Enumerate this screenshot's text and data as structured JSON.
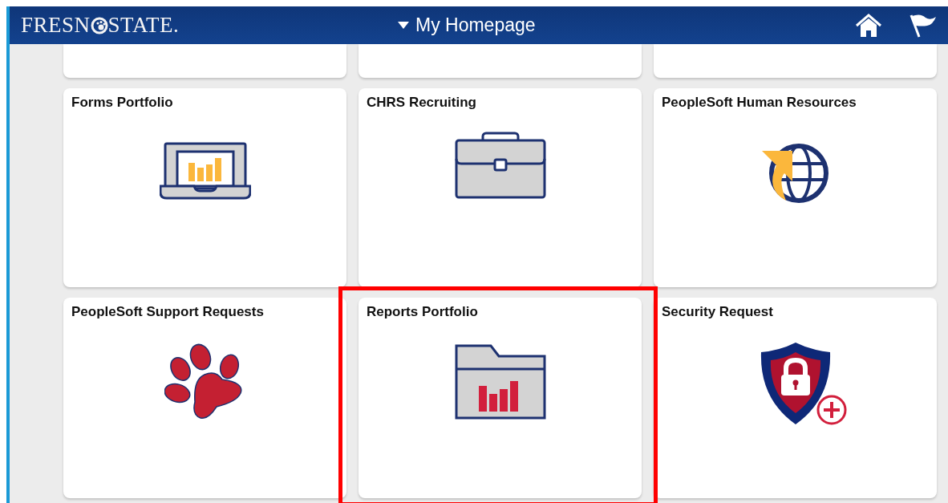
{
  "header": {
    "logo": {
      "before": "FRESN",
      "after": "STATE."
    },
    "title": "My Homepage"
  },
  "tiles": [
    {
      "kind": "cut"
    },
    {
      "kind": "cut"
    },
    {
      "kind": "cut"
    },
    {
      "kind": "laptop",
      "title": "Forms Portfolio",
      "highlighted": false
    },
    {
      "kind": "briefcase",
      "title": "CHRS Recruiting",
      "highlighted": false
    },
    {
      "kind": "globe",
      "title": "PeopleSoft Human Resources",
      "highlighted": false
    },
    {
      "kind": "paw",
      "title": "PeopleSoft Support Requests",
      "highlighted": false
    },
    {
      "kind": "folder",
      "title": "Reports Portfolio",
      "highlighted": true
    },
    {
      "kind": "shield",
      "title": "Security Request",
      "highlighted": false
    }
  ]
}
